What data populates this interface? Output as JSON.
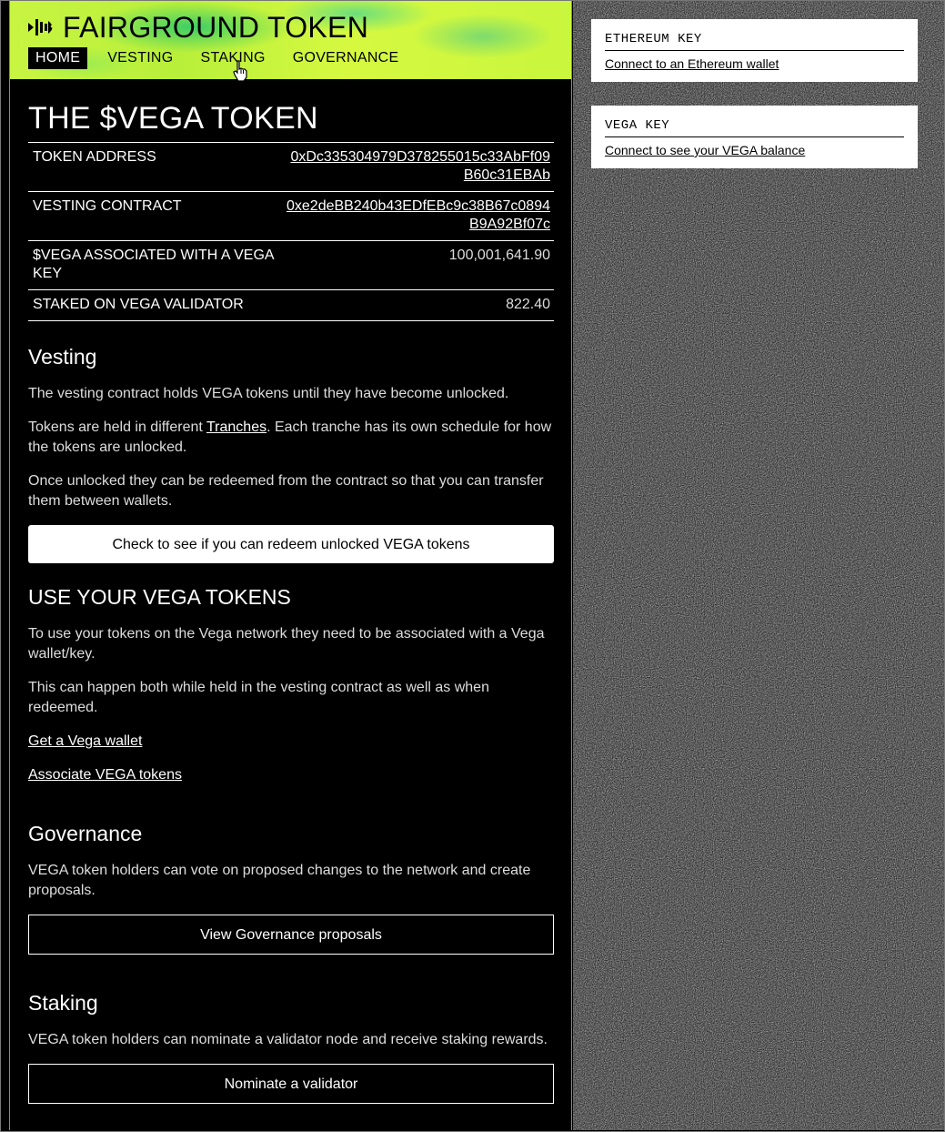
{
  "header": {
    "title": "FAIRGROUND TOKEN",
    "nav": [
      {
        "label": "HOME",
        "active": true
      },
      {
        "label": "VESTING",
        "active": false
      },
      {
        "label": "STAKING",
        "active": false
      },
      {
        "label": "GOVERNANCE",
        "active": false
      }
    ],
    "accent_color": "#c8f542"
  },
  "main": {
    "title": "THE $VEGA TOKEN",
    "info_rows": [
      {
        "label": "TOKEN ADDRESS",
        "value": "0xDc335304979D378255015c33AbFf09B60c31EBAb"
      },
      {
        "label": "VESTING CONTRACT",
        "value": "0xe2deBB240b43EDfEBc9c38B67c0894B9A92Bf07c"
      },
      {
        "label": "$VEGA ASSOCIATED WITH A VEGA KEY",
        "value": "100,001,641.90"
      },
      {
        "label": "STAKED ON VEGA VALIDATOR",
        "value": "822.40"
      }
    ],
    "vesting": {
      "heading": "Vesting",
      "p1": "The vesting contract holds VEGA tokens until they have become unlocked.",
      "p2_pre": "Tokens are held in different ",
      "p2_link": "Tranches",
      "p2_post": ". Each tranche has its own schedule for how the tokens are unlocked.",
      "p3": "Once unlocked they can be redeemed from the contract so that you can transfer them between wallets.",
      "button": "Check to see if you can redeem unlocked VEGA tokens"
    },
    "use": {
      "heading": "USE YOUR VEGA TOKENS",
      "p1": "To use your tokens on the Vega network they need to be associated with a Vega wallet/key.",
      "p2": "This can happen both while held in the vesting contract as well as when redeemed.",
      "link1": "Get a Vega wallet",
      "link2": "Associate VEGA tokens"
    },
    "governance": {
      "heading": "Governance",
      "p1": "VEGA token holders can vote on proposed changes to the network and create proposals.",
      "button": "View Governance proposals"
    },
    "staking": {
      "heading": "Staking",
      "p1": "VEGA token holders can nominate a validator node and receive staking rewards.",
      "button": "Nominate a validator"
    }
  },
  "sidebar": {
    "ethereum": {
      "title": "ETHEREUM KEY",
      "link": "Connect to an Ethereum wallet"
    },
    "vega": {
      "title": "VEGA KEY",
      "link": "Connect to see your VEGA balance"
    }
  }
}
